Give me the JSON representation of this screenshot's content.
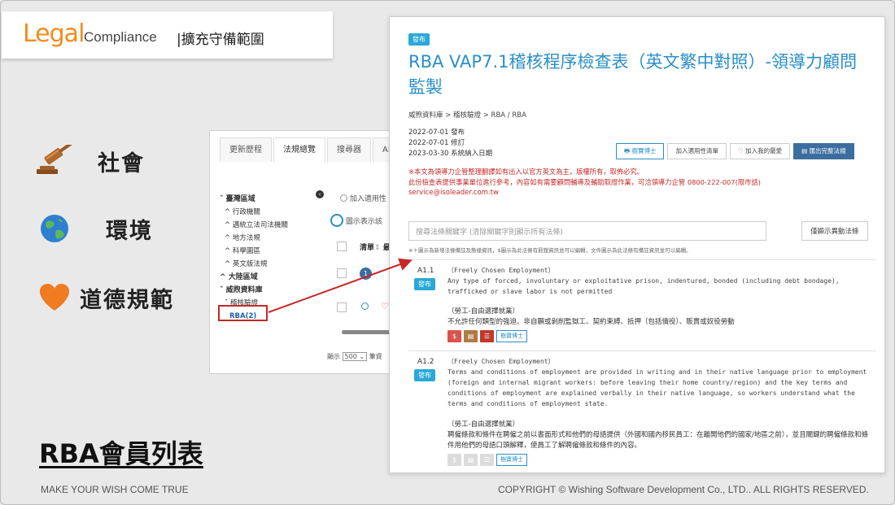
{
  "banner": {
    "logo_legal": "Legal",
    "logo_compliance": "Compliance",
    "subtitle": "|擴充守備範圍"
  },
  "topics": [
    {
      "icon": "gavel-icon",
      "label": "社會"
    },
    {
      "icon": "globe-icon",
      "label": "環境"
    },
    {
      "icon": "heart-icon",
      "label": "道德規範"
    }
  ],
  "section_title": "RBA會員列表",
  "footer": {
    "left": "MAKE YOUR WISH COME TRUE",
    "right": "COPYRIGHT © Wishing Software Development Co., LTD.. ALL RIGHTS RESERVED."
  },
  "app1": {
    "tabs": [
      "更新歷程",
      "法規總覽",
      "搜尋器",
      "AI智能"
    ],
    "tree": [
      {
        "label": "臺灣區域",
        "level": 0
      },
      {
        "label": "行政機關",
        "level": 1
      },
      {
        "label": "邁統立法司法機關",
        "level": 1
      },
      {
        "label": "地方法規",
        "level": 1
      },
      {
        "label": "科學園區",
        "level": 1
      },
      {
        "label": "英文版法規",
        "level": 1
      },
      {
        "label": "大陸區域",
        "level": 0
      },
      {
        "label": "威煦資料庫",
        "level": 0
      },
      {
        "label": "稽核驗證",
        "level": 1
      },
      {
        "label": "RBA(2)",
        "level": 2
      }
    ],
    "add_label": "加入適用性",
    "show_label": "圖示表示該",
    "list_header": "清單",
    "list_header2": "最",
    "count": "1",
    "page_size_label": "顯示",
    "page_size": "500",
    "page_suffix": "筆資"
  },
  "doc": {
    "badge": "發布",
    "title": "RBA VAP7.1稽核程序檢查表（英文繁中對照）-領導力顧問監製",
    "breadcrumb": "威煦資料庫 > 稽核驗證 > RBA / RBA",
    "dates": [
      "2022-07-01 發布",
      "2022-07-01 修訂",
      "2023-03-30 系統納入日期"
    ],
    "buttons": [
      "樹寶博士",
      "加入適用性清單",
      "加入我的最愛",
      "匯出完整法規"
    ],
    "notice_lines": [
      "※本文為領導力企管整理翻譯如有出入以官方英文為主，版權所有，取佈必究。",
      "此份檢查表提供事業單位進行參考，內容如有需要顧問輔導及輔助取證作業，可洽領導力企管 0800-222-007(限市話)"
    ],
    "email": "service@isoleader.com.tw",
    "search_placeholder": "搜尋法條關鍵字 (清除關鍵字則顯示所有法條)",
    "show_changed": "僅顯示異動法條",
    "legend_note": "※＋圖示為新增法條備註及態樣資訊，$圖示為此法條有罰鍰資訊並可以編輯，文件圖示為此法條有備註資訊並可以編輯。",
    "entries": [
      {
        "code": "A1.1",
        "badge": "發布",
        "en_title": "（Freely Chosen Employment）",
        "en_text": "Any type of forced, involuntary or exploitative prison, indentured, bonded (including debt bondage), trafficked or slave labor is not permitted",
        "zh_title": "（勞工-自由選擇就業）",
        "zh_text": "不允許任何類型的強迫、非自願或剝削監獄工、契約束縛、抵押（包括債役）、販賣或奴役勞動",
        "chip": "樹寶博士"
      },
      {
        "code": "A1.2",
        "badge": "發布",
        "en_title": "（Freely Chosen Employment）",
        "en_text": "Terms and conditions of employment are provided in writing and in their native language prior to employment (foreign and internal migrant workers: before leaving their home country/region) and the key terms and conditions of employment are explained verbally in their native language, so workers understand what the terms and conditions of employment state.",
        "zh_title": "（勞工-自由選擇就業）",
        "zh_text": "聘僱條款和條件在聘僱之前以書面形式和他們的母語提供（外國和國內移民員工：在離開他們的國家/地區之前），並且關鍵的聘僱條款和條件用他們的母語口頭解釋，使員工了解聘僱條款和條件的內容。",
        "chip": "樹寶博士"
      }
    ]
  },
  "colors": {
    "accent": "#2a8fc7",
    "brand_orange": "#f28c1e",
    "highlight_red": "#c62828"
  }
}
